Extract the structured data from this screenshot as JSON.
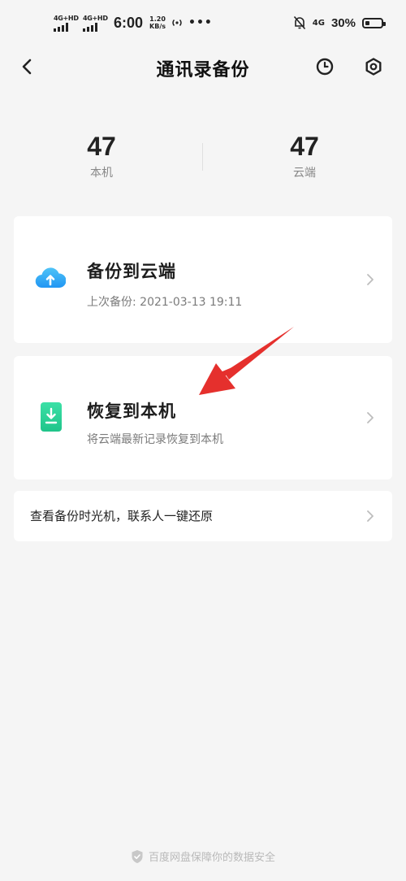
{
  "status_bar": {
    "network1": "4G+HD",
    "network2": "4G+HD",
    "time": "6:00",
    "speed_value": "1.20",
    "speed_unit": "KB/s",
    "more": "•••",
    "network3": "4G",
    "battery_pct": "30%",
    "battery_level": 0.3
  },
  "header": {
    "title": "通讯录备份"
  },
  "stats": {
    "local_count": "47",
    "local_label": "本机",
    "cloud_count": "47",
    "cloud_label": "云端"
  },
  "backup_card": {
    "title": "备份到云端",
    "subtitle": "上次备份: 2021-03-13 19:11"
  },
  "restore_card": {
    "title": "恢复到本机",
    "subtitle": "将云端最新记录恢复到本机"
  },
  "timemachine_row": {
    "label": "查看备份时光机，联系人一键还原"
  },
  "footer": {
    "text": "百度网盘保障你的数据安全"
  },
  "colors": {
    "background": "#f5f5f5",
    "cloud_icon": "#3aa0f0",
    "restore_icon": "#2fd39a",
    "annotation_arrow": "#e5302d"
  }
}
